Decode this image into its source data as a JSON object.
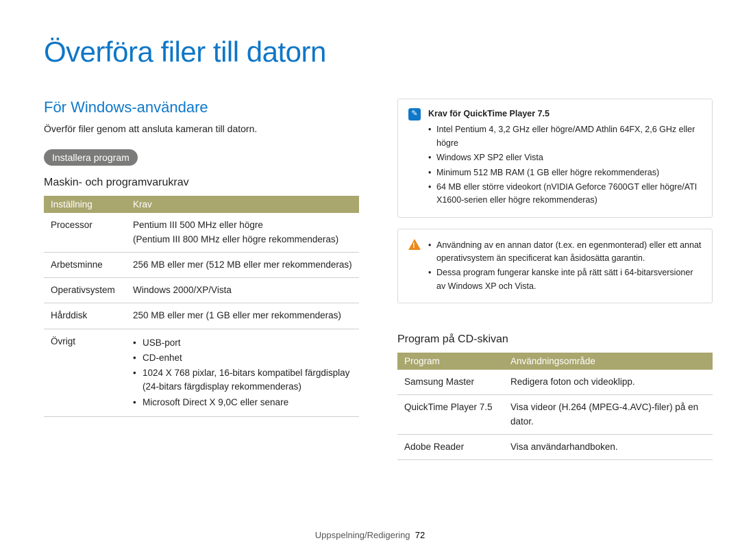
{
  "title": "Överföra filer till datorn",
  "subtitle": "För Windows-användare",
  "intro": "Överför filer genom att ansluta kameran till datorn.",
  "pill": "Installera program",
  "req_heading": "Maskin- och programvarukrav",
  "table1": {
    "head": {
      "c1": "Inställning",
      "c2": "Krav"
    },
    "rows": {
      "r0": {
        "label": "Processor",
        "value": "Pentium III 500 MHz eller högre\n(Pentium III 800 MHz eller högre rekommenderas)"
      },
      "r1": {
        "label": "Arbetsminne",
        "value": "256 MB eller mer (512 MB eller mer rekommenderas)"
      },
      "r2": {
        "label": "Operativsystem",
        "value": "Windows 2000/XP/Vista"
      },
      "r3": {
        "label": "Hårddisk",
        "value": "250 MB eller mer (1 GB eller mer rekommenderas)"
      },
      "r4": {
        "label": "Övrigt",
        "items": {
          "i0": "USB-port",
          "i1": "CD-enhet",
          "i2": "1024 X 768 pixlar, 16-bitars kompatibel färgdisplay (24-bitars färgdisplay rekommenderas)",
          "i3": "Microsoft Direct X 9,0C eller senare"
        }
      }
    }
  },
  "qt_box": {
    "heading": "Krav för QuickTime Player 7.5",
    "items": {
      "i0": "Intel Pentium 4, 3,2 GHz eller högre/AMD Athlin 64FX, 2,6 GHz eller högre",
      "i1": "Windows XP SP2 eller Vista",
      "i2": "Minimum 512 MB RAM (1 GB eller högre rekommenderas)",
      "i3": "64 MB eller större videokort (nVIDIA Geforce 7600GT eller högre/ATI X1600-serien eller högre rekommenderas)"
    }
  },
  "warn_box": {
    "items": {
      "i0": "Användning av en annan dator (t.ex. en egenmonterad) eller ett annat operativsystem än specificerat kan åsidosätta garantin.",
      "i1": "Dessa program fungerar kanske inte på rätt sätt i 64-bitarsversioner av Windows XP och Vista."
    }
  },
  "cd_heading": "Program på CD-skivan",
  "table2": {
    "head": {
      "c1": "Program",
      "c2": "Användningsområde"
    },
    "rows": {
      "r0": {
        "label": "Samsung Master",
        "value": "Redigera foton och videoklipp."
      },
      "r1": {
        "label": "QuickTime Player 7.5",
        "value": "Visa videor (H.264 (MPEG-4.AVC)-filer) på en dator."
      },
      "r2": {
        "label": "Adobe Reader",
        "value": "Visa användarhandboken."
      }
    }
  },
  "footer": {
    "section": "Uppspelning/Redigering",
    "page": "72"
  }
}
